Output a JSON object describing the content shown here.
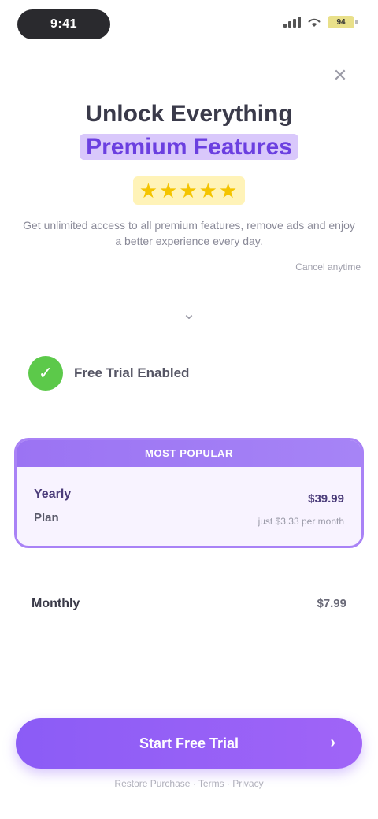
{
  "status_bar": {
    "time": "9:41",
    "battery": "94"
  },
  "close": {
    "icon": "close-icon",
    "glyph": "✕"
  },
  "hero": {
    "title": "Unlock Everything",
    "title_accent": "Premium Features",
    "stars": "★★★★★",
    "subtitle": "Get unlimited access to all premium features, remove ads and enjoy a better experience every day.",
    "note": "Cancel anytime"
  },
  "more": {
    "icon": "chevron-down-icon",
    "glyph": "⌄"
  },
  "trial": {
    "label": "Free Trial Enabled",
    "check_glyph": "✓"
  },
  "plans": {
    "featured": {
      "badge": "MOST POPULAR",
      "name": "Yearly",
      "period": "Plan",
      "price": "$39.99",
      "detail": "just $3.33 per month"
    },
    "secondary": {
      "name": "Monthly",
      "price": "$7.99"
    }
  },
  "cta": {
    "label": "Start Free Trial",
    "arrow": "›"
  },
  "footer": {
    "note": "Restore Purchase · Terms · Privacy"
  }
}
